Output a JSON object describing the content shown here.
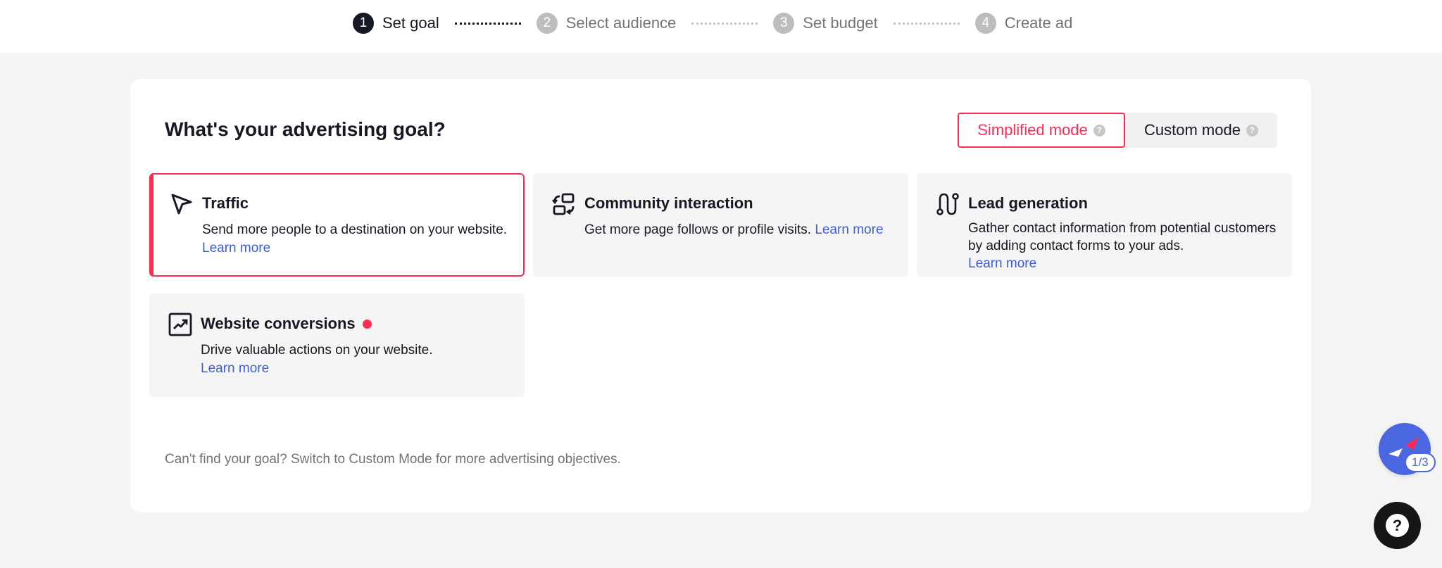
{
  "stepper": {
    "steps": [
      {
        "number": "1",
        "label": "Set goal",
        "state": "active"
      },
      {
        "number": "2",
        "label": "Select audience",
        "state": "pending"
      },
      {
        "number": "3",
        "label": "Set budget",
        "state": "pending"
      },
      {
        "number": "4",
        "label": "Create ad",
        "state": "pending"
      }
    ]
  },
  "panel": {
    "title": "What's your advertising goal?",
    "modes": {
      "simplified": "Simplified mode",
      "custom": "Custom mode",
      "help_glyph": "?",
      "selected": "simplified"
    },
    "goals": [
      {
        "icon": "cursor-arrow-icon",
        "title": "Traffic",
        "description": "Send more people to a destination on your website.",
        "link": "Learn more",
        "selected": true,
        "new_badge": false
      },
      {
        "icon": "community-swap-icon",
        "title": "Community interaction",
        "description": "Get more page follows or profile visits.",
        "link": "Learn more",
        "selected": false,
        "new_badge": false
      },
      {
        "icon": "lead-path-icon",
        "title": "Lead generation",
        "description": "Gather contact information from potential customers by adding contact forms to your ads.",
        "link": "Learn more",
        "selected": false,
        "new_badge": false
      },
      {
        "icon": "trend-chart-icon",
        "title": "Website conversions",
        "description": "Drive valuable actions on your website.",
        "link": "Learn more",
        "selected": false,
        "new_badge": true
      }
    ],
    "footer_note": "Can't find your goal? Switch to Custom Mode for more advertising objectives."
  },
  "floating": {
    "guide_progress": "1/3",
    "help_glyph": "?"
  },
  "colors": {
    "accent": "#fe2c55",
    "link": "#3d5ed6",
    "text": "#161823",
    "muted": "#737373",
    "guide_blue": "#4a66e0"
  }
}
